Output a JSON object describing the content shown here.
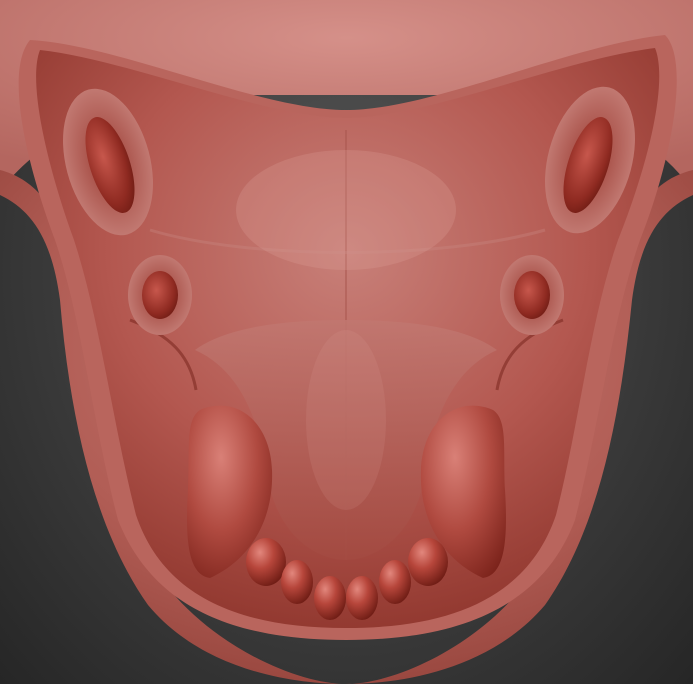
{
  "scene": {
    "subject": "sculpted-creature-palate",
    "colors": {
      "background_light": "#5a5a5a",
      "background_dark": "#262626",
      "skin_light": "#c97a74",
      "skin_mid": "#b2554d",
      "skin_dark": "#7d2a22",
      "tooth_base": "#a8342a",
      "tooth_highlight": "#e2877d"
    }
  }
}
